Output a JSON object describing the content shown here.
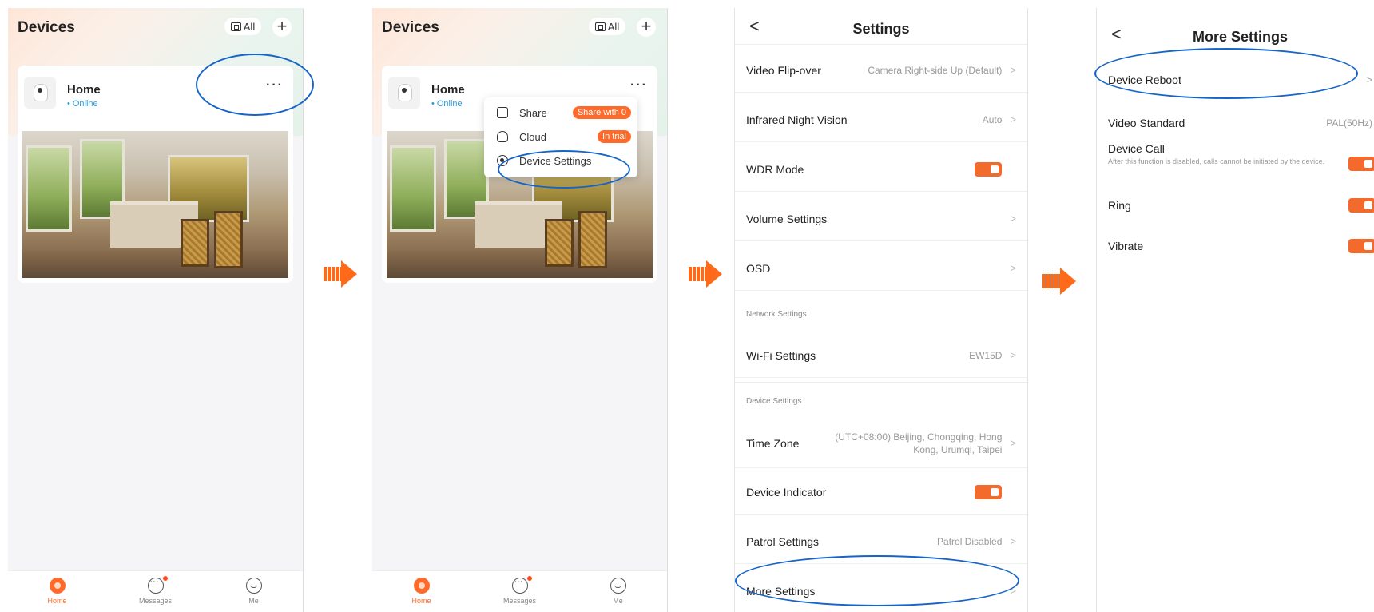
{
  "devices": {
    "title": "Devices",
    "all_label": "All",
    "add_label": "+",
    "device_name": "Home",
    "device_status": "Online",
    "more_label": "···"
  },
  "tabs": [
    {
      "label": "Home",
      "icon": "home-icon"
    },
    {
      "label": "Messages",
      "icon": "messages-icon"
    },
    {
      "label": "Me",
      "icon": "user-icon"
    }
  ],
  "popup": {
    "share_label": "Share",
    "share_badge": "Share with 0",
    "cloud_label": "Cloud",
    "cloud_badge": "In trial",
    "settings_label": "Device Settings"
  },
  "settings": {
    "title": "Settings",
    "back": "<",
    "rows": [
      {
        "label": "Video Flip-over",
        "value": "Camera Right-side Up (Default)"
      },
      {
        "label": "Infrared Night Vision",
        "value": "Auto"
      },
      {
        "label": "WDR Mode",
        "value": ""
      },
      {
        "label": "Volume Settings",
        "value": ""
      },
      {
        "label": "OSD",
        "value": ""
      }
    ],
    "network_section": "Network Settings",
    "wifi": {
      "label": "Wi-Fi Settings",
      "value": "EW15D"
    },
    "device_section": "Device Settings",
    "timezone": {
      "label": "Time Zone",
      "value": "(UTC+08:00) Beijing, Chongqing, Hong Kong, Urumqi, Taipei"
    },
    "indicator": {
      "label": "Device Indicator"
    },
    "patrol": {
      "label": "Patrol Settings",
      "value": "Patrol Disabled"
    },
    "more": {
      "label": "More Settings"
    }
  },
  "more_settings": {
    "title": "More Settings",
    "back": "<",
    "reboot": "Device Reboot",
    "video_standard": {
      "label": "Video Standard",
      "value": "PAL(50Hz)"
    },
    "device_call": {
      "label": "Device Call",
      "desc": "After this function is disabled, calls cannot be initiated by the device."
    },
    "ring": "Ring",
    "vibrate": "Vibrate"
  },
  "colors": {
    "accent": "#f26a2c",
    "highlight_ring": "#1565c8",
    "status_online": "#2a9cd8"
  }
}
